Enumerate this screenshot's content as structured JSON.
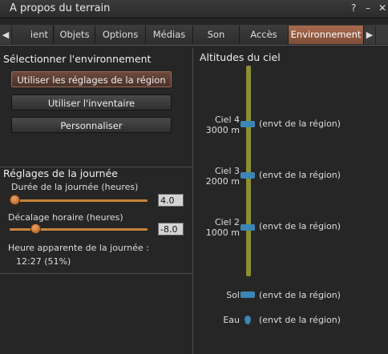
{
  "window": {
    "title": "A propos du terrain",
    "help_label": "?",
    "minimize_label": "–",
    "close_label": "✕"
  },
  "tabs": {
    "prev_icon": "◀",
    "next_icon": "▶",
    "items": [
      {
        "label": "ient"
      },
      {
        "label": "Objets"
      },
      {
        "label": "Options"
      },
      {
        "label": "Médias"
      },
      {
        "label": "Son"
      },
      {
        "label": "Accès"
      },
      {
        "label": "Environnement"
      }
    ],
    "active_index": 6
  },
  "env_select": {
    "title": "Sélectionner l'environnement",
    "btn_region": "Utiliser les réglages de la région",
    "btn_inventory": "Utiliser l'inventaire",
    "btn_custom": "Personnaliser"
  },
  "day_settings": {
    "title": "Réglages de la journée",
    "day_length_label": "Durée de la journée (heures)",
    "day_length_value": "4.0",
    "day_length_fraction": 0.0,
    "offset_label": "Décalage horaire (heures)",
    "offset_value": "-8.0",
    "offset_fraction": 0.16,
    "apparent_label": "Heure apparente de la journée :",
    "apparent_value": "12:27 (51%)"
  },
  "sky": {
    "title": "Altitudes du ciel",
    "levels": [
      {
        "name": "Ciel 4",
        "altitude": "3000 m",
        "env": "(envt de la région)"
      },
      {
        "name": "Ciel 3",
        "altitude": "2000 m",
        "env": "(envt de la région)"
      },
      {
        "name": "Ciel 2",
        "altitude": "1000 m",
        "env": "(envt de la région)"
      }
    ],
    "ground": {
      "name": "Sol",
      "env": "(envt de la région)"
    },
    "water": {
      "name": "Eau",
      "env": "(envt de la région)"
    }
  },
  "colors": {
    "accent": "#a86a4e",
    "slider": "#c8843a",
    "stem": "#8c8f33",
    "marker": "#3c86b5"
  }
}
